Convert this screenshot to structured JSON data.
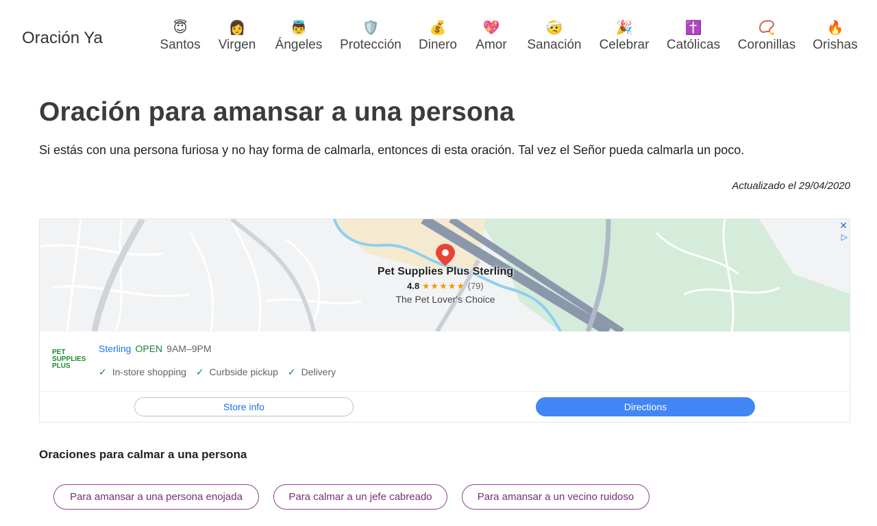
{
  "header": {
    "brand": "Oración Ya",
    "nav": [
      {
        "emoji": "😇",
        "label": "Santos",
        "color": "#f6c343"
      },
      {
        "emoji": "👩",
        "label": "Virgen",
        "color": "#c77a2e"
      },
      {
        "emoji": "👼",
        "label": "Ángeles",
        "color": "#5b9bd5"
      },
      {
        "emoji": "🛡️",
        "label": "Protección",
        "color": "#7d8fa6"
      },
      {
        "emoji": "💰",
        "label": "Dinero",
        "color": "#d49a1b"
      },
      {
        "emoji": "💖",
        "label": "Amor",
        "color": "#e0508a"
      },
      {
        "emoji": "🤕",
        "label": "Sanación",
        "color": "#f2c14e"
      },
      {
        "emoji": "🎉",
        "label": "Celebrar",
        "color": "#e57a2c"
      },
      {
        "emoji": "✝️",
        "label": "Católicas",
        "color": "#9b4fcf"
      },
      {
        "emoji": "📿",
        "label": "Coronillas",
        "color": "#d8443a"
      },
      {
        "emoji": "🔥",
        "label": "Orishas",
        "color": "#f2701c"
      }
    ]
  },
  "main": {
    "title": "Oración para amansar a una persona",
    "lead": "Si estás con una persona furiosa y no hay forma de calmarla, entonces di esta oración. Tal vez el Señor pueda calmarla un poco.",
    "updated": "Actualizado el 29/04/2020"
  },
  "ad": {
    "close_icon": "✕",
    "adchoices_icon": "▷",
    "store_name": "Pet Supplies Plus Sterling",
    "rating": "4.8",
    "stars": "★★★★★",
    "review_count": "(79)",
    "tagline": "The Pet Lover's Choice",
    "logo_lines": [
      "PET",
      "SUPPLIES",
      "PLUS"
    ],
    "city": "Sterling",
    "open_status": "OPEN",
    "hours": "9AM–9PM",
    "features": [
      "In-store shopping",
      "Curbside pickup",
      "Delivery"
    ],
    "check_icon": "✓",
    "store_info_label": "Store info",
    "directions_label": "Directions",
    "colors": {
      "link": "#1a73e8",
      "open": "#188038",
      "button": "#4285f4",
      "pin": "#ea4335"
    }
  },
  "related": {
    "title": "Oraciones para calmar a una persona",
    "chips": [
      "Para amansar a una persona enojada",
      "Para calmar a un jefe cabreado",
      "Para amansar a un vecino ruidoso"
    ],
    "accent": "#7a2c78"
  }
}
